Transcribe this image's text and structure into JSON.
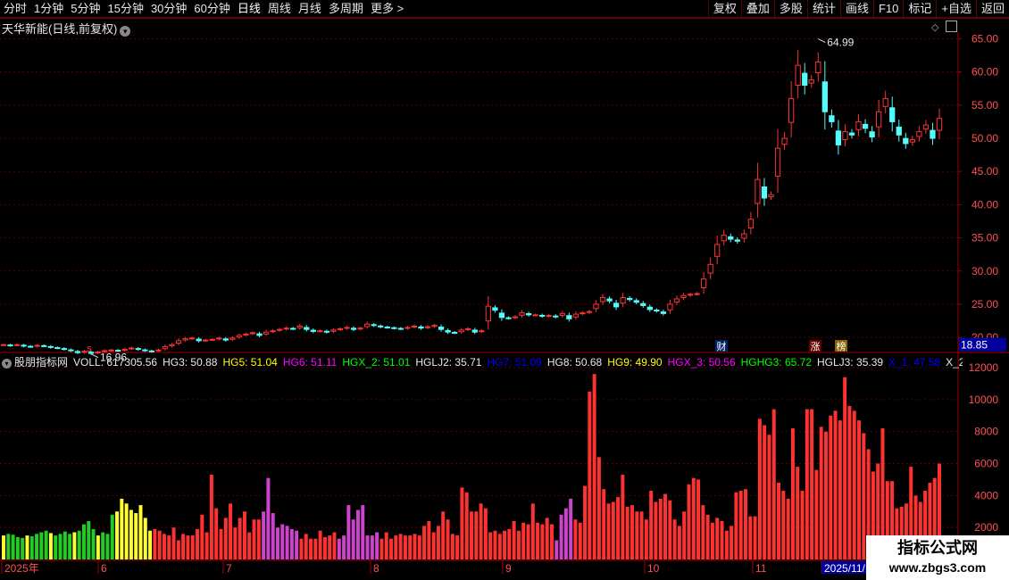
{
  "toolbar": {
    "tabs": [
      "分时",
      "1分钟",
      "5分钟",
      "15分钟",
      "30分钟",
      "60分钟",
      "日线",
      "周线",
      "月线",
      "多周期",
      "更多 >"
    ],
    "active_tab": "日线",
    "right_buttons": [
      "复权",
      "叠加",
      "多股",
      "统计",
      "画线",
      "F10",
      "标记",
      "+自选",
      "返回"
    ]
  },
  "chart": {
    "title": "天华新能(日线,前复权)",
    "current_price": "18.85",
    "high_label": "64.99",
    "low_label": "16.96",
    "markers": {
      "s": "s",
      "cai": "财",
      "zhang": "涨",
      "bang": "榜"
    }
  },
  "indicator": {
    "name": "股朋指标网",
    "values": [
      {
        "text": "VOLL: 617305.56",
        "color": "#e8e8e8"
      },
      {
        "text": "HG3: 50.88",
        "color": "#e8e8e8"
      },
      {
        "text": "HG5: 51.04",
        "color": "#ffff00"
      },
      {
        "text": "HG6: 51.11",
        "color": "#ff00ff"
      },
      {
        "text": "HGX_2: 51.01",
        "color": "#00ff00"
      },
      {
        "text": "HGLJ2: 35.71",
        "color": "#e8e8e8"
      },
      {
        "text": "HG7: 51.09",
        "color": "#0000ff"
      },
      {
        "text": "HG8: 50.68",
        "color": "#e8e8e8"
      },
      {
        "text": "HG9: 49.90",
        "color": "#ffff00"
      },
      {
        "text": "HGX_3: 50.56",
        "color": "#ff00ff"
      },
      {
        "text": "HGHG3: 65.72",
        "color": "#00ff00"
      },
      {
        "text": "HGLJ3: 35.39",
        "color": "#e8e8e8"
      },
      {
        "text": "X_1: 47.58",
        "color": "#0000ff"
      },
      {
        "text": "X_2",
        "color": "#e8e8e8"
      }
    ]
  },
  "date_axis": [
    "2025年",
    "6",
    "7",
    "8",
    "9",
    "10",
    "11",
    "2025/11/1"
  ],
  "watermark": {
    "line1": "指标公式网",
    "line2": "www.zbgs3.com"
  },
  "colors": {
    "up": "#ff3232",
    "down": "#54fcfc",
    "grid": "#5a0000",
    "axis": "#a00000"
  },
  "chart_data": [
    {
      "type": "candlestick",
      "title": "天华新能(日线,前复权)",
      "y_ticks": [
        "65.00",
        "60.00",
        "55.00",
        "50.00",
        "45.00",
        "40.00",
        "35.00",
        "30.00",
        "25.00",
        "20.00"
      ],
      "ylim": [
        18,
        66
      ],
      "x_labels": [
        "2025年",
        "6",
        "7",
        "8",
        "9",
        "10",
        "11",
        "2025/11/1"
      ],
      "close": [
        18.9,
        18.8,
        18.9,
        18.7,
        18.6,
        18.8,
        18.7,
        18.5,
        18.4,
        18.2,
        18.0,
        17.7,
        17.9,
        17.6,
        17.8,
        18.0,
        18.1,
        18.0,
        18.2,
        18.4,
        18.2,
        18.0,
        17.9,
        18.1,
        18.6,
        18.9,
        19.5,
        19.8,
        19.9,
        19.5,
        19.6,
        19.7,
        19.9,
        19.6,
        19.9,
        20.3,
        20.5,
        20.7,
        20.3,
        20.8,
        21.0,
        21.2,
        21.4,
        21.3,
        21.7,
        21.2,
        20.9,
        21.0,
        20.8,
        21.1,
        21.3,
        21.5,
        21.2,
        21.4,
        22.0,
        21.8,
        21.6,
        21.5,
        21.4,
        21.3,
        21.5,
        21.7,
        21.4,
        21.6,
        21.8,
        21.2,
        20.8,
        20.7,
        21.1,
        21.3,
        20.8,
        21.0,
        24.7,
        24.1,
        23.0,
        22.9,
        23.1,
        23.7,
        23.4,
        23.4,
        23.2,
        23.3,
        23.1,
        23.6,
        22.8,
        23.5,
        23.7,
        23.9,
        25.0,
        26.0,
        25.5,
        24.6,
        26.0,
        25.7,
        25.3,
        24.8,
        24.2,
        24.0,
        23.6,
        25.0,
        25.8,
        26.3,
        26.5,
        26.6,
        28.8,
        31.0,
        34.0,
        35.4,
        34.8,
        34.5,
        35.6,
        37.8,
        43.8,
        41.0,
        41.5,
        48.5,
        50.0,
        56.0,
        61.0,
        58.0,
        58.8,
        61.5,
        54.0,
        52.5,
        49.0,
        51.0,
        50.5,
        52.5,
        51.5,
        50.2,
        54.0,
        56.0,
        52.5,
        50.5,
        49.2,
        49.8,
        51.0,
        52.0,
        50.0,
        53.0
      ],
      "volume": [
        1500,
        1600,
        1550,
        1400,
        1350,
        1500,
        1450,
        1600,
        1700,
        1800,
        1650,
        1500,
        1600,
        1750,
        1600,
        1700,
        1800,
        2200,
        2400,
        1900,
        1500,
        1700,
        1600,
        2800,
        3000,
        3800,
        3500,
        3100,
        2900,
        3400,
        2600,
        1800,
        1900,
        1800,
        1600,
        1500,
        2000,
        1200,
        1600,
        1500,
        1500,
        1900,
        2800,
        1700,
        5300,
        3200,
        1900,
        2600,
        3500,
        2000,
        2600,
        3000,
        1700,
        2500,
        2500,
        3000,
        5100,
        2900,
        2000,
        2200,
        2100,
        1900,
        1800,
        1300,
        1600,
        1300,
        1300,
        1800,
        1400,
        1500,
        1700,
        1300,
        1500,
        3400,
        2500,
        3100,
        3400,
        1500,
        1500,
        1700,
        1300,
        1700,
        1300,
        1500,
        1600,
        1500,
        1500,
        1600,
        1500,
        2100,
        2400,
        1700,
        2100,
        3000,
        2500,
        1600,
        1500,
        4500,
        4200,
        3000,
        3000,
        3500,
        3200,
        1700,
        1800,
        1600,
        1800,
        1900,
        2400,
        1800,
        2300,
        2200,
        3500,
        2300,
        2200,
        2600,
        2200,
        1200,
        2800,
        3200,
        3800,
        2500,
        2300,
        4600,
        10500,
        11600,
        6400,
        4400,
        3500,
        3600,
        3900,
        5300,
        3300,
        3400,
        3000,
        3000,
        2500,
        4300,
        3600,
        3800,
        4100,
        3700,
        2500,
        2100,
        3000,
        4700,
        5100,
        5000,
        3400,
        2800,
        2300,
        2600,
        2400,
        1800,
        2100,
        4200,
        4300,
        4400,
        2700,
        2700,
        8800,
        8400,
        7800,
        9400,
        4800,
        4300,
        3800,
        8200,
        5800,
        4300,
        9400,
        9400,
        5600,
        8300,
        8000,
        9000,
        9300,
        8700,
        11400,
        9600,
        9300,
        8700,
        7900,
        6900,
        5500,
        6000,
        8200,
        4900,
        4900,
        3200,
        3300,
        3500,
        5800,
        4000,
        3600,
        4300,
        4800,
        5100,
        6000
      ]
    }
  ]
}
